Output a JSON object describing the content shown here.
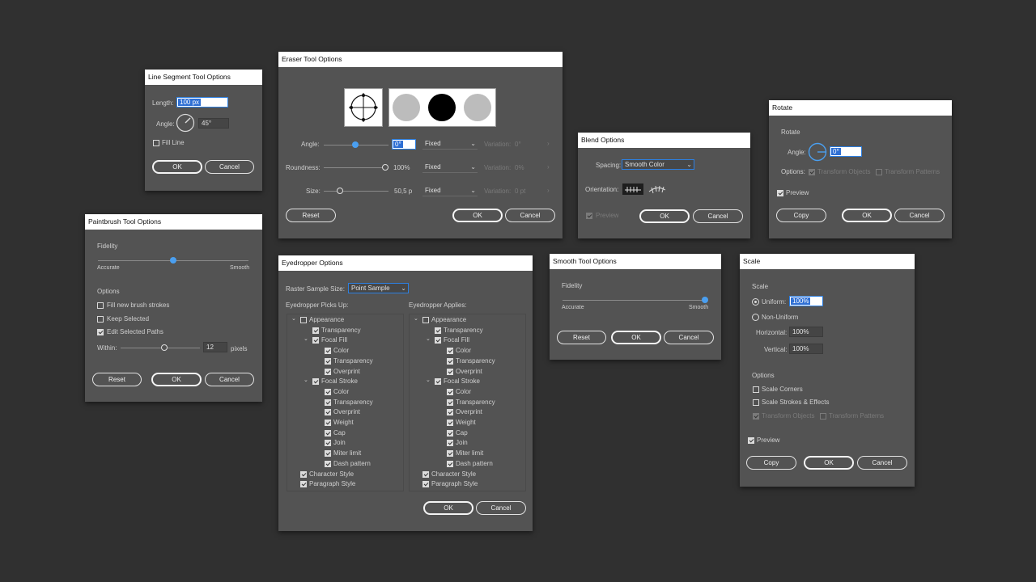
{
  "line_segment": {
    "title": "Line Segment Tool Options",
    "length_label": "Length:",
    "length_value": "100 px",
    "angle_label": "Angle:",
    "angle_value": "45°",
    "fill_line": "Fill Line",
    "ok": "OK",
    "cancel": "Cancel"
  },
  "eraser": {
    "title": "Eraser Tool Options",
    "angle_label": "Angle:",
    "angle_value": "0°",
    "angle_mode": "Fixed",
    "angle_variation": "Variation:",
    "angle_var_value": "0°",
    "roundness_label": "Roundness:",
    "roundness_value": "100%",
    "roundness_mode": "Fixed",
    "roundness_variation": "Variation:",
    "roundness_var_value": "0%",
    "size_label": "Size:",
    "size_value": "50,5 p",
    "size_mode": "Fixed",
    "size_variation": "Variation:",
    "size_var_value": "0 pt",
    "reset": "Reset",
    "ok": "OK",
    "cancel": "Cancel"
  },
  "blend": {
    "title": "Blend Options",
    "spacing_label": "Spacing:",
    "spacing_value": "Smooth Color",
    "orientation_label": "Orientation:",
    "preview": "Preview",
    "ok": "OK",
    "cancel": "Cancel"
  },
  "rotate": {
    "title": "Rotate",
    "section": "Rotate",
    "angle_label": "Angle:",
    "angle_value": "0°",
    "options_label": "Options:",
    "transform_objects": "Transform Objects",
    "transform_patterns": "Transform Patterns",
    "preview": "Preview",
    "copy": "Copy",
    "ok": "OK",
    "cancel": "Cancel"
  },
  "paintbrush": {
    "title": "Paintbrush Tool Options",
    "fidelity": "Fidelity",
    "accurate": "Accurate",
    "smooth": "Smooth",
    "options": "Options",
    "fill_new": "Fill new brush strokes",
    "keep_selected": "Keep Selected",
    "edit_selected": "Edit Selected Paths",
    "within_label": "Within:",
    "within_value": "12",
    "within_unit": "pixels",
    "reset": "Reset",
    "ok": "OK",
    "cancel": "Cancel"
  },
  "eyedropper": {
    "title": "Eyedropper Options",
    "raster_label": "Raster Sample Size:",
    "raster_value": "Point Sample",
    "picks_up": "Eyedropper Picks Up:",
    "applies": "Eyedropper Applies:",
    "tree": [
      {
        "label": "Appearance",
        "level": 0,
        "twist": true,
        "checked": false
      },
      {
        "label": "Transparency",
        "level": 1,
        "twist": false,
        "checked": true
      },
      {
        "label": "Focal Fill",
        "level": 1,
        "twist": true,
        "checked": true
      },
      {
        "label": "Color",
        "level": 2,
        "twist": false,
        "checked": true
      },
      {
        "label": "Transparency",
        "level": 2,
        "twist": false,
        "checked": true
      },
      {
        "label": "Overprint",
        "level": 2,
        "twist": false,
        "checked": true
      },
      {
        "label": "Focal Stroke",
        "level": 1,
        "twist": true,
        "checked": true
      },
      {
        "label": "Color",
        "level": 2,
        "twist": false,
        "checked": true
      },
      {
        "label": "Transparency",
        "level": 2,
        "twist": false,
        "checked": true
      },
      {
        "label": "Overprint",
        "level": 2,
        "twist": false,
        "checked": true
      },
      {
        "label": "Weight",
        "level": 2,
        "twist": false,
        "checked": true
      },
      {
        "label": "Cap",
        "level": 2,
        "twist": false,
        "checked": true
      },
      {
        "label": "Join",
        "level": 2,
        "twist": false,
        "checked": true
      },
      {
        "label": "Miter limit",
        "level": 2,
        "twist": false,
        "checked": true
      },
      {
        "label": "Dash pattern",
        "level": 2,
        "twist": false,
        "checked": true
      },
      {
        "label": "Character Style",
        "level": 0,
        "twist": false,
        "checked": true
      },
      {
        "label": "Paragraph Style",
        "level": 0,
        "twist": false,
        "checked": true
      }
    ],
    "ok": "OK",
    "cancel": "Cancel"
  },
  "smooth": {
    "title": "Smooth Tool Options",
    "fidelity": "Fidelity",
    "accurate": "Accurate",
    "smooth": "Smooth",
    "reset": "Reset",
    "ok": "OK",
    "cancel": "Cancel"
  },
  "scale": {
    "title": "Scale",
    "section": "Scale",
    "uniform_label": "Uniform:",
    "uniform_value": "100%",
    "non_uniform": "Non-Uniform",
    "horizontal_label": "Horizontal:",
    "horizontal_value": "100%",
    "vertical_label": "Vertical:",
    "vertical_value": "100%",
    "options": "Options",
    "scale_corners": "Scale Corners",
    "scale_strokes": "Scale Strokes & Effects",
    "transform_objects": "Transform Objects",
    "transform_patterns": "Transform Patterns",
    "preview": "Preview",
    "copy": "Copy",
    "ok": "OK",
    "cancel": "Cancel"
  },
  "colors": {
    "background": "#303030",
    "dialog": "#535353",
    "accent": "#4a9ff0"
  }
}
